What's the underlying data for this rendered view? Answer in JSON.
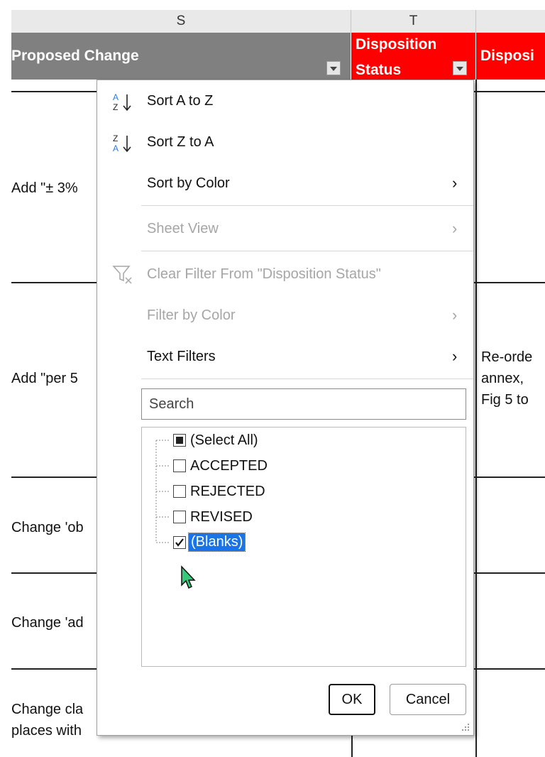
{
  "spreadsheet": {
    "columns": [
      "S",
      "T"
    ],
    "headers": {
      "proposed_change": "Proposed Change",
      "disposition_status_line1": "Disposition",
      "disposition_status_line2": "Status",
      "disposition_partial": "Disposi"
    },
    "cells": {
      "row1_change": "Add \"± 3%",
      "row2_change": "Add \"per 5",
      "row2_disp_line1": "Re-orde",
      "row2_disp_line2": "annex, ",
      "row2_disp_line3": "Fig 5 to",
      "row3_change": "Change 'ob",
      "row4_change": "Change 'ad",
      "row5_change_line1": "Change cla",
      "row5_change_line2": "places with"
    },
    "colors": {
      "header_gray": "#808080",
      "header_red": "#ff0000"
    }
  },
  "filter_menu": {
    "sort_a_to_z": "Sort A to Z",
    "sort_z_to_a": "Sort Z to A",
    "sort_by_color": "Sort by Color",
    "sheet_view": "Sheet View",
    "clear_filter": "Clear Filter From \"Disposition Status\"",
    "filter_by_color": "Filter by Color",
    "text_filters": "Text Filters",
    "search_placeholder": "Search",
    "items": [
      {
        "label": "(Select All)",
        "state": "indeterminate"
      },
      {
        "label": "ACCEPTED",
        "state": "unchecked"
      },
      {
        "label": "REJECTED",
        "state": "unchecked"
      },
      {
        "label": "REVISED",
        "state": "unchecked"
      },
      {
        "label": "(Blanks)",
        "state": "checked"
      }
    ],
    "ok": "OK",
    "cancel": "Cancel",
    "selection_color": "#1a73e8"
  }
}
